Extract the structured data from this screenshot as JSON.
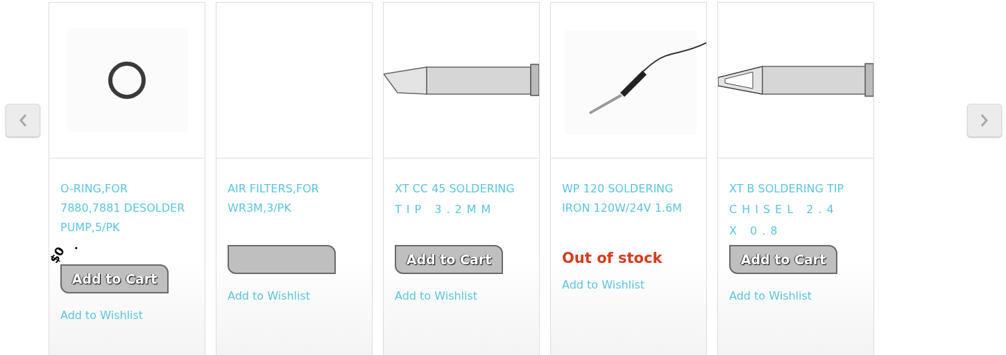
{
  "products": [
    {
      "title_lines": [
        {
          "text": "O-RING,FOR",
          "kind": "normal"
        },
        {
          "text": "7880,7881 DESOLDER",
          "kind": "normal"
        },
        {
          "text": "PUMP,5/PK",
          "kind": "normal"
        }
      ],
      "price_parts": [
        "$0",
        "."
      ],
      "cart_button": {
        "label": "Add to Cart"
      },
      "wishlist": "Add to Wishlist"
    },
    {
      "title_lines": [
        {
          "text": "AIR FILTERS,FOR",
          "kind": "normal"
        },
        {
          "text": "WR3M,3/PK",
          "kind": "normal"
        }
      ],
      "cart_button": {
        "kind": "blank"
      },
      "wishlist": "Add to Wishlist"
    },
    {
      "title_lines": [
        {
          "text": "XT CC 45 SOLDERING",
          "kind": "normal"
        },
        {
          "text": "TIP 3.2MM",
          "kind": "spaced"
        }
      ],
      "cart_button": {
        "label": "Add to Cart"
      },
      "wishlist": "Add to Wishlist"
    },
    {
      "title_lines": [
        {
          "text": "WP 120 SOLDERING",
          "kind": "normal"
        },
        {
          "text": "IRON 120W/24V 1.6M",
          "kind": "normal"
        }
      ],
      "stock": "Out of stock",
      "wishlist": "Add to Wishlist"
    },
    {
      "title_lines": [
        {
          "text": "XT B SOLDERING TIP",
          "kind": "normal"
        },
        {
          "text": "CHISEL 2.4",
          "kind": "spaced"
        },
        {
          "text": "X 0.8",
          "kind": "spaced"
        }
      ],
      "cart_button": {
        "label": "Add to Cart"
      },
      "wishlist": "Add to Wishlist"
    }
  ]
}
